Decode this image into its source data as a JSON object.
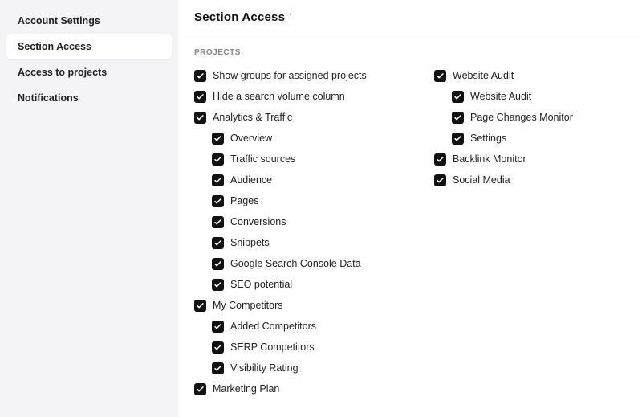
{
  "sidebar": {
    "items": [
      {
        "label": "Account Settings",
        "active": false
      },
      {
        "label": "Section Access",
        "active": true
      },
      {
        "label": "Access to projects",
        "active": false
      },
      {
        "label": "Notifications",
        "active": false
      }
    ]
  },
  "header": {
    "title": "Section Access",
    "info_mark": "i"
  },
  "section_label": "PROJECTS",
  "left": {
    "items": [
      {
        "label": "Show groups for assigned projects",
        "checked": true,
        "child": false
      },
      {
        "label": "Hide a search volume column",
        "checked": true,
        "child": false
      },
      {
        "label": "Analytics & Traffic",
        "checked": true,
        "child": false
      },
      {
        "label": "Overview",
        "checked": true,
        "child": true
      },
      {
        "label": "Traffic sources",
        "checked": true,
        "child": true
      },
      {
        "label": "Audience",
        "checked": true,
        "child": true
      },
      {
        "label": "Pages",
        "checked": true,
        "child": true
      },
      {
        "label": "Conversions",
        "checked": true,
        "child": true
      },
      {
        "label": "Snippets",
        "checked": true,
        "child": true
      },
      {
        "label": "Google Search Console Data",
        "checked": true,
        "child": true
      },
      {
        "label": "SEO potential",
        "checked": true,
        "child": true
      },
      {
        "label": "My Competitors",
        "checked": true,
        "child": false
      },
      {
        "label": "Added Competitors",
        "checked": true,
        "child": true
      },
      {
        "label": "SERP Competitors",
        "checked": true,
        "child": true
      },
      {
        "label": "Visibility Rating",
        "checked": true,
        "child": true
      },
      {
        "label": "Marketing Plan",
        "checked": true,
        "child": false
      }
    ]
  },
  "right": {
    "items": [
      {
        "label": "Website Audit",
        "checked": true,
        "child": false
      },
      {
        "label": "Website Audit",
        "checked": true,
        "child": true
      },
      {
        "label": "Page Changes Monitor",
        "checked": true,
        "child": true
      },
      {
        "label": "Settings",
        "checked": true,
        "child": true
      },
      {
        "label": "Backlink Monitor",
        "checked": true,
        "child": false
      },
      {
        "label": "Social Media",
        "checked": true,
        "child": false
      }
    ]
  }
}
